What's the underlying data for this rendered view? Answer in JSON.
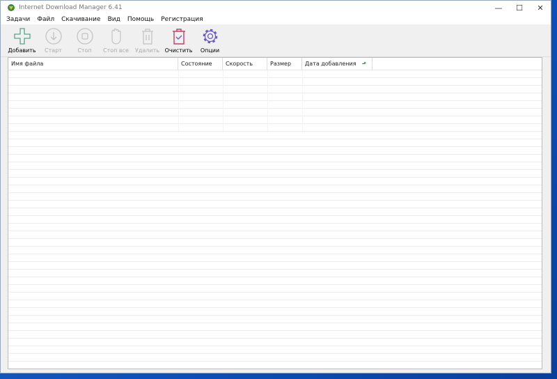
{
  "window": {
    "title": "Internet Download Manager 6.41"
  },
  "menu": [
    "Задачи",
    "Файл",
    "Скачивание",
    "Вид",
    "Помощь",
    "Регистрация"
  ],
  "toolbar": [
    {
      "label": "Добавить",
      "icon": "plus-icon",
      "enabled": true
    },
    {
      "label": "Старт",
      "icon": "download-arrow-icon",
      "enabled": false
    },
    {
      "label": "Стоп",
      "icon": "stop-icon",
      "enabled": false
    },
    {
      "label": "Стоп все",
      "icon": "hand-icon",
      "enabled": false
    },
    {
      "label": "Удалить",
      "icon": "trash-icon",
      "enabled": false
    },
    {
      "label": "Очистить",
      "icon": "clear-trash-icon",
      "enabled": true
    },
    {
      "label": "Опции",
      "icon": "gear-icon",
      "enabled": true
    }
  ],
  "columns": [
    "Имя файла",
    "Состояние",
    "Скорость",
    "Размер",
    "Дата добавления"
  ],
  "colors": {
    "add": "#5aa58a",
    "clear": "#c0406a",
    "options": "#6a5ac8",
    "disabled": "#c4c4c4"
  }
}
